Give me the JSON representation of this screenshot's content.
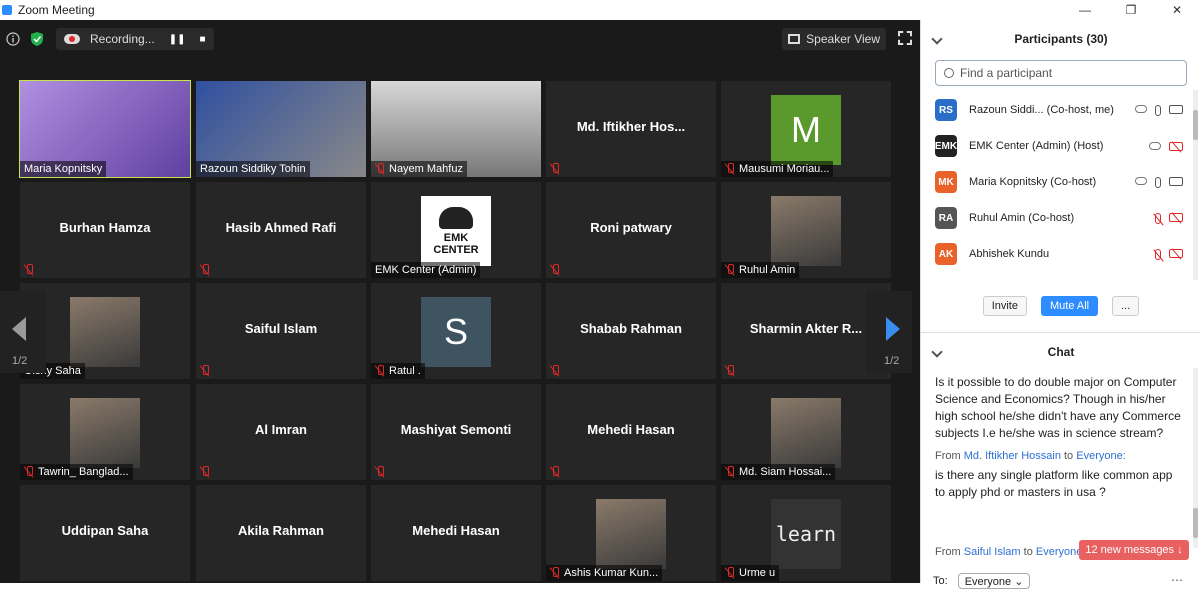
{
  "window": {
    "title": "Zoom Meeting"
  },
  "topbar": {
    "recording_label": "Recording...",
    "speaker_view_label": "Speaker View"
  },
  "tiles": [
    {
      "name": "Maria Kopnitsky",
      "center": "",
      "muted": false,
      "kind": "video"
    },
    {
      "name": "Razoun Siddiky Tohin",
      "center": "",
      "muted": false,
      "kind": "video"
    },
    {
      "name": "Nayem Mahfuz",
      "center": "",
      "muted": true,
      "kind": "video"
    },
    {
      "name": "",
      "center": "Md. Iftikher Hos...",
      "muted": true,
      "kind": "name"
    },
    {
      "name": "Mausumi Moriau...",
      "center": "",
      "muted": true,
      "kind": "avatar",
      "initial": "M",
      "color": "#5a9a2c"
    },
    {
      "name": "",
      "center": "Burhan Hamza",
      "muted": true,
      "kind": "name"
    },
    {
      "name": "",
      "center": "Hasib Ahmed Rafi",
      "muted": true,
      "kind": "name"
    },
    {
      "name": "EMK Center (Admin)",
      "center": "",
      "muted": false,
      "kind": "logo"
    },
    {
      "name": "",
      "center": "Roni patwary",
      "muted": true,
      "kind": "name"
    },
    {
      "name": "Ruhul Amin",
      "center": "",
      "muted": true,
      "kind": "photo"
    },
    {
      "name": "Oishy Saha",
      "center": "",
      "muted": false,
      "kind": "photo"
    },
    {
      "name": "",
      "center": "Saiful Islam",
      "muted": true,
      "kind": "name"
    },
    {
      "name": "Ratul .",
      "center": "",
      "muted": true,
      "kind": "avatar",
      "initial": "S",
      "color": "#3e5460"
    },
    {
      "name": "",
      "center": "Shabab Rahman",
      "muted": true,
      "kind": "name"
    },
    {
      "name": "",
      "center": "Sharmin Akter R...",
      "muted": true,
      "kind": "name"
    },
    {
      "name": "Tawrin_ Banglad...",
      "center": "",
      "muted": true,
      "kind": "photo"
    },
    {
      "name": "",
      "center": "Al Imran",
      "muted": true,
      "kind": "name"
    },
    {
      "name": "",
      "center": "Mashiyat Semonti",
      "muted": true,
      "kind": "name"
    },
    {
      "name": "",
      "center": "Mehedi Hasan",
      "muted": true,
      "kind": "name"
    },
    {
      "name": "Md. Siam Hossai...",
      "center": "",
      "muted": true,
      "kind": "photo"
    },
    {
      "name": "",
      "center": "Uddipan Saha",
      "muted": false,
      "kind": "name"
    },
    {
      "name": "",
      "center": "Akila Rahman",
      "muted": false,
      "kind": "name"
    },
    {
      "name": "",
      "center": "Mehedi Hasan",
      "muted": false,
      "kind": "name"
    },
    {
      "name": "Ashis Kumar Kun...",
      "center": "",
      "muted": true,
      "kind": "photo"
    },
    {
      "name": "Urme u",
      "center": "",
      "muted": true,
      "kind": "learn"
    }
  ],
  "logo_text": {
    "line1": "EMK",
    "line2": "CENTER"
  },
  "learn_text": "learn",
  "pagination": {
    "left": "1/2",
    "right": "1/2"
  },
  "participants": {
    "title": "Participants (30)",
    "search_placeholder": "Find a participant",
    "rows": [
      {
        "initials": "RS",
        "color": "#2a6fc7",
        "name": "Razoun Siddi... (Co-host, me)",
        "mic": "on",
        "cam": "on"
      },
      {
        "initials": "EMK",
        "color": "#222222",
        "name": "EMK Center (Admin) (Host)",
        "mic": "none",
        "cam": "off"
      },
      {
        "initials": "MK",
        "color": "#e8622a",
        "name": "Maria Kopnitsky (Co-host)",
        "mic": "on",
        "cam": "on"
      },
      {
        "initials": "RA",
        "color": "#555555",
        "name": "Ruhul Amin (Co-host)",
        "mic": "off",
        "cam": "off"
      },
      {
        "initials": "AK",
        "color": "#e8622a",
        "name": "Abhishek Kundu",
        "mic": "off",
        "cam": "off"
      }
    ],
    "invite_label": "Invite",
    "mute_all_label": "Mute All",
    "more_label": "..."
  },
  "chat": {
    "title": "Chat",
    "message1": "Is it possible to do double major on Computer Science and Economics? Though in his/her high school he/she didn't have any Commerce subjects I.e he/she was in science stream?",
    "from2_prefix": "From",
    "from2_name": "Md. Iftikher Hossain",
    "from2_mid": "to",
    "from2_target": "Everyone:",
    "message2": "is there any single platform like common app to apply phd or masters in usa ?",
    "from3_prefix": "From",
    "from3_name": "Saiful Islam",
    "from3_mid": "to",
    "from3_target": "Everyone:",
    "new_messages": "12 new messages ↓",
    "to_label": "To:",
    "to_value": "Everyone ⌄"
  }
}
